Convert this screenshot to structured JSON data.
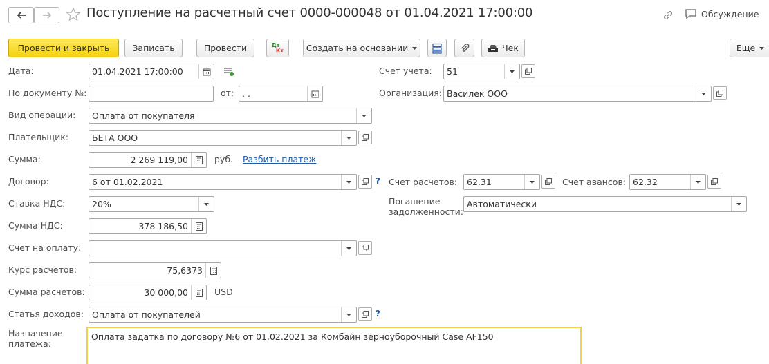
{
  "window": {
    "title": "Поступление на расчетный счет 0000-000048 от 01.04.2021 17:00:00",
    "discussion_label": "Обсуждение"
  },
  "toolbar": {
    "post_and_close": "Провести и закрыть",
    "save": "Записать",
    "post": "Провести",
    "dtkt_top": "Дт",
    "dtkt_bottom": "Кт",
    "create_based_on": "Создать на основании",
    "receipt": "Чек",
    "more": "Еще"
  },
  "form": {
    "date_label": "Дата:",
    "date_value": "01.04.2021 17:00:00",
    "doc_num_label": "По документу №:",
    "doc_num_value": "",
    "from_label": "от:",
    "from_value": " .  .",
    "operation_label": "Вид операции:",
    "operation_value": "Оплата от покупателя",
    "payer_label": "Плательщик:",
    "payer_value": "БЕТА ООО",
    "sum_label": "Сумма:",
    "sum_value": "2 269 119,00",
    "sum_currency": "руб.",
    "split_payment": "Разбить платеж",
    "contract_label": "Договор:",
    "contract_value": "6 от 01.02.2021",
    "vat_rate_label": "Ставка НДС:",
    "vat_rate_value": "20%",
    "vat_sum_label": "Сумма НДС:",
    "vat_sum_value": "378 186,50",
    "invoice_label": "Счет на оплату:",
    "invoice_value": "",
    "rate_label": "Курс расчетов:",
    "rate_value": "75,6373",
    "settle_sum_label": "Сумма расчетов:",
    "settle_sum_value": "30 000,00",
    "settle_currency": "USD",
    "income_item_label": "Статья доходов:",
    "income_item_value": "Оплата от покупателей",
    "purpose_label_1": "Назначение",
    "purpose_label_2": "платежа:",
    "purpose_value": "Оплата задатка по договору №6 от 01.02.2021 за Комбайн зерноуборочный Case AF150",
    "account_label": "Счет учета:",
    "account_value": "51",
    "org_label": "Организация:",
    "org_value": "Василек ООО",
    "settle_acc_label": "Счет расчетов:",
    "settle_acc_value": "62.31",
    "advance_acc_label": "Счет авансов:",
    "advance_acc_value": "62.32",
    "debt_label_1": "Погашение",
    "debt_label_2": "задолженности:",
    "debt_value": "Автоматически",
    "help_mark": "?"
  }
}
